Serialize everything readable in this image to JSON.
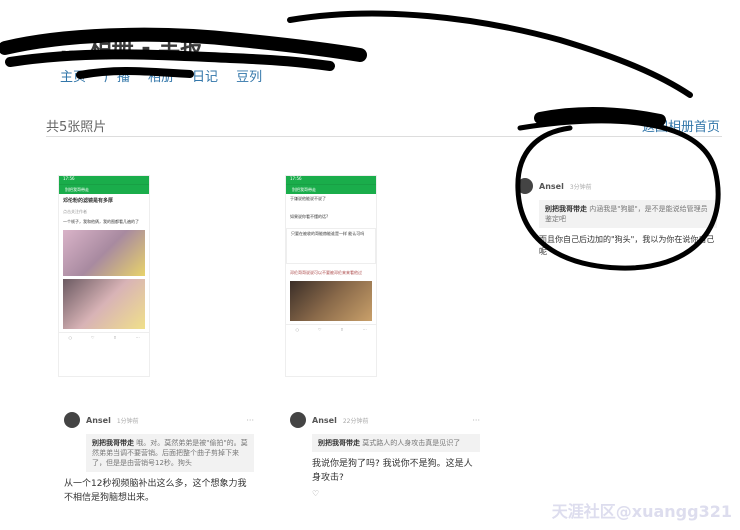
{
  "header": {
    "title": "… 相册 - 羊报",
    "nav": [
      "主页",
      "广播",
      "相册",
      "日记",
      "豆列"
    ]
  },
  "album": {
    "count_label": "共5张照片",
    "back_label": "返回相册首页"
  },
  "phone1": {
    "status": "17:56",
    "header_title": "别把我哥带走",
    "post_title": "邓伦粉的滤镜是有多厚",
    "meta": "点击关注作者",
    "text": "一个帧子，我和他俩，我的图都看几遍的了"
  },
  "phone2": {
    "status": "17:56",
    "header_title": "别把我哥带走",
    "q1": "于谦说他能说不说了",
    "q2": "如果说你看不懂的话?",
    "q3": "只要在被收的哥能赫能谁是一样 能认可吗",
    "q4": "邓伦哥哥说说可以不要被邓伦来来看他过"
  },
  "comment_right": {
    "user": "Ansel",
    "time": "3分钟前",
    "quote_user": "别把我哥带走",
    "quote_text": "内涵我是\"狗腿\"，是不是能说给管理员鉴定吧",
    "text": "而且你自己后边加的\"狗头\"，我以为你在说你自己呢"
  },
  "comment_left": {
    "user": "Ansel",
    "time": "1分钟前",
    "quote_user": "别把我哥带走",
    "quote_text": "哦。对。莫然弟弟是被\"偷拍\"的。莫然弟弟当调不要营销。后面把整个曲子剪掉下来了，但是是由营销号12秒。狗头",
    "text": "从一个12秒视频脑补出这么多，这个想象力我不相信是狗脑想出来。"
  },
  "comment_mid": {
    "user": "Ansel",
    "time": "22分钟前",
    "quote_user": "别把我哥带走",
    "quote_text": "莫式路人的人身攻击真是见识了",
    "text": "我说你是狗了吗? 我说你不是狗。这是人身攻击?"
  },
  "watermark": "天涯社区@xuangg321",
  "more_glyph": "···"
}
